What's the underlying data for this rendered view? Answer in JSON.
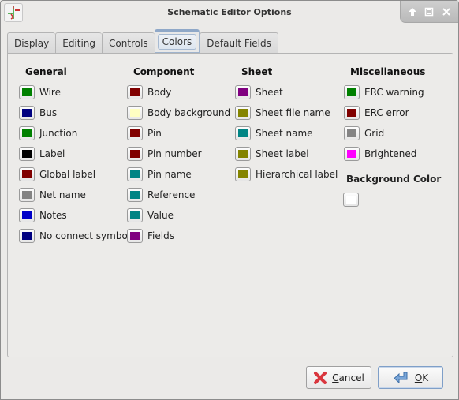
{
  "window": {
    "title": "Schematic Editor Options",
    "controls": [
      "shade",
      "maximize",
      "close"
    ]
  },
  "tabs": [
    {
      "label": "Display",
      "active": false
    },
    {
      "label": "Editing",
      "active": false
    },
    {
      "label": "Controls",
      "active": false
    },
    {
      "label": "Colors",
      "active": true
    },
    {
      "label": "Default Fields",
      "active": false
    }
  ],
  "groups": {
    "general": {
      "title": "General",
      "items": [
        {
          "label": "Wire",
          "color": "#008000"
        },
        {
          "label": "Bus",
          "color": "#000080"
        },
        {
          "label": "Junction",
          "color": "#008000"
        },
        {
          "label": "Label",
          "color": "#000000"
        },
        {
          "label": "Global label",
          "color": "#800000"
        },
        {
          "label": "Net name",
          "color": "#848484"
        },
        {
          "label": "Notes",
          "color": "#0000c8"
        },
        {
          "label": "No connect symbol",
          "color": "#000080"
        }
      ]
    },
    "component": {
      "title": "Component",
      "items": [
        {
          "label": "Body",
          "color": "#800000"
        },
        {
          "label": "Body background",
          "color": "#ffffc2"
        },
        {
          "label": "Pin",
          "color": "#800000"
        },
        {
          "label": "Pin number",
          "color": "#800000"
        },
        {
          "label": "Pin name",
          "color": "#008484"
        },
        {
          "label": "Reference",
          "color": "#008484"
        },
        {
          "label": "Value",
          "color": "#008484"
        },
        {
          "label": "Fields",
          "color": "#800080"
        }
      ]
    },
    "sheet": {
      "title": "Sheet",
      "items": [
        {
          "label": "Sheet",
          "color": "#800080"
        },
        {
          "label": "Sheet file name",
          "color": "#848400"
        },
        {
          "label": "Sheet name",
          "color": "#008484"
        },
        {
          "label": "Sheet label",
          "color": "#848400"
        },
        {
          "label": "Hierarchical label",
          "color": "#848400"
        }
      ]
    },
    "misc": {
      "title": "Miscellaneous",
      "items": [
        {
          "label": "ERC warning",
          "color": "#008000"
        },
        {
          "label": "ERC error",
          "color": "#800000"
        },
        {
          "label": "Grid",
          "color": "#848484"
        },
        {
          "label": "Brightened",
          "color": "#ff00ff"
        }
      ],
      "background": {
        "title": "Background Color",
        "color": "#ffffff"
      }
    }
  },
  "buttons": {
    "cancel": {
      "label": "Cancel",
      "mnemonic": "C",
      "rest": "ancel"
    },
    "ok": {
      "label": "OK",
      "mnemonic": "O",
      "rest": "K"
    }
  }
}
